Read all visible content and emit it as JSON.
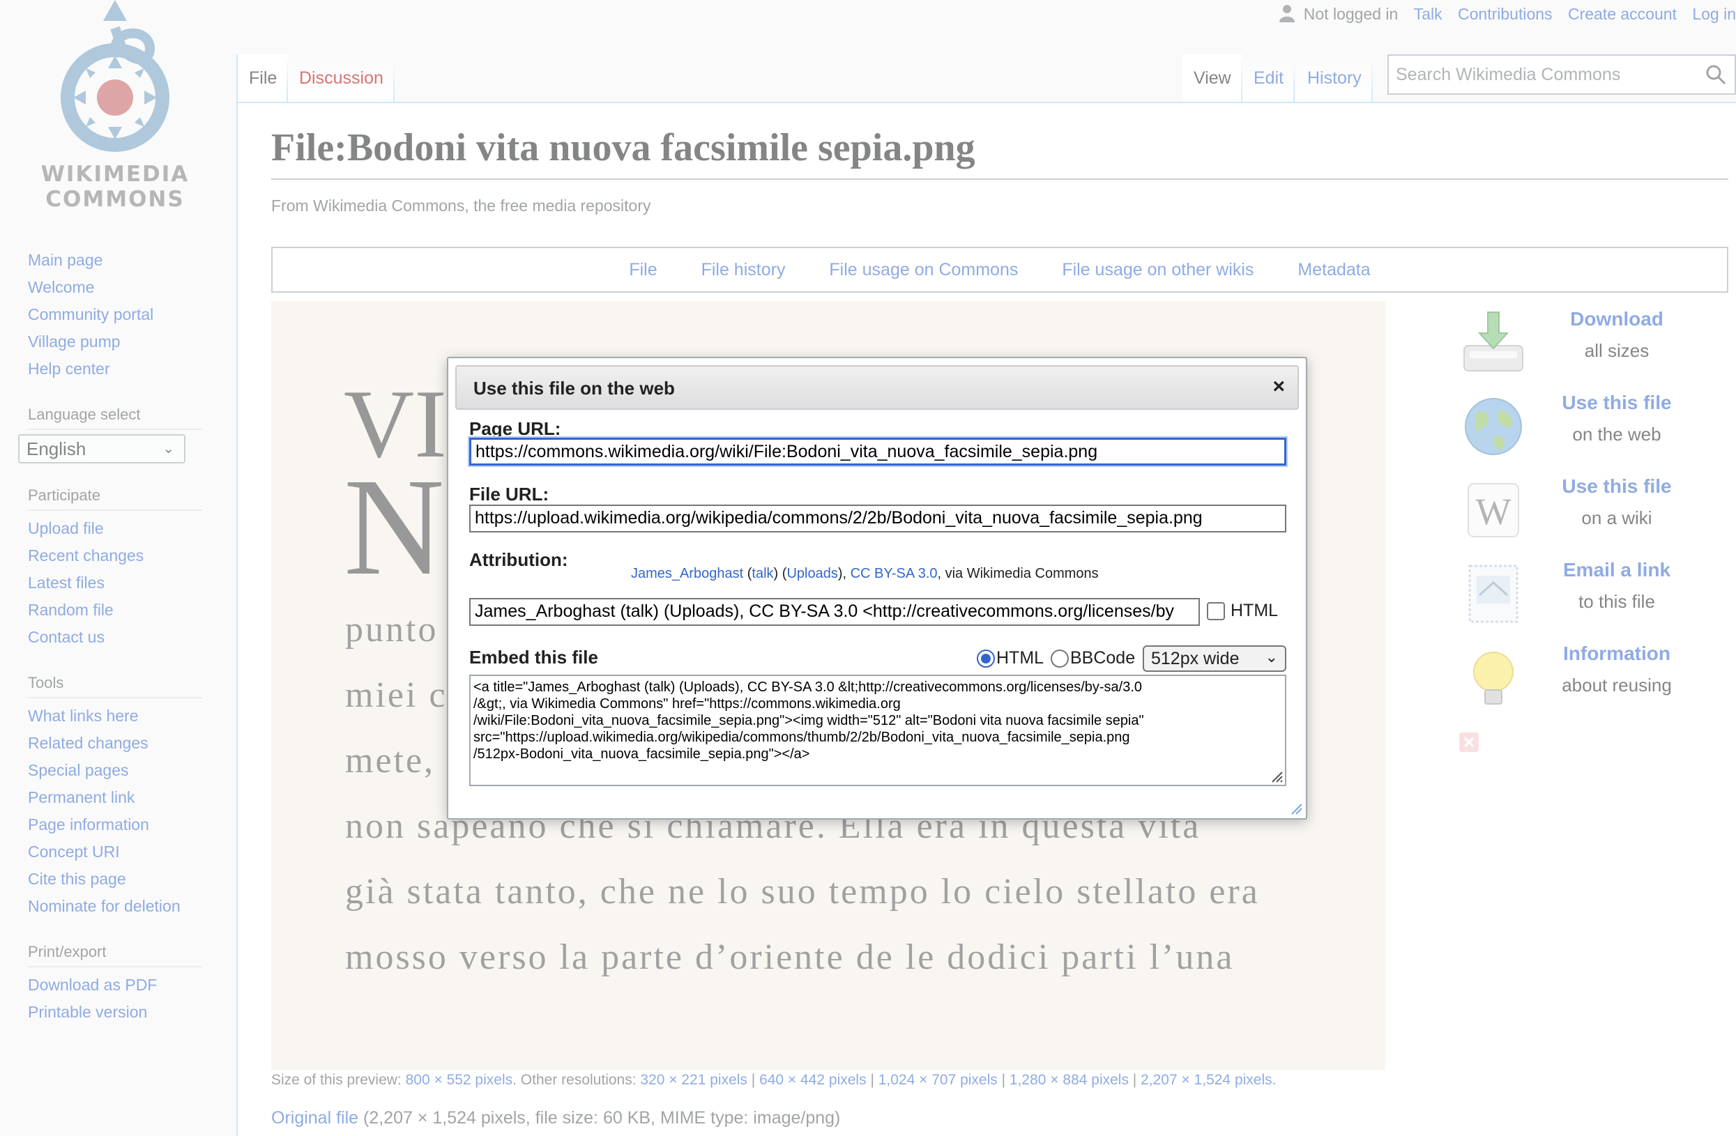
{
  "logo": {
    "line1": "WIKIMEDIA",
    "line2": "COMMONS"
  },
  "personal": {
    "not_logged_in": "Not logged in",
    "talk": "Talk",
    "contributions": "Contributions",
    "create_account": "Create account",
    "log_in": "Log in"
  },
  "sidebar": {
    "nav": [
      "Main page",
      "Welcome",
      "Community portal",
      "Village pump",
      "Help center"
    ],
    "language_head": "Language select",
    "language_value": "English",
    "participate_head": "Participate",
    "participate": [
      "Upload file",
      "Recent changes",
      "Latest files",
      "Random file",
      "Contact us"
    ],
    "tools_head": "Tools",
    "tools": [
      "What links here",
      "Related changes",
      "Special pages",
      "Permanent link",
      "Page information",
      "Concept URI",
      "Cite this page",
      "Nominate for deletion"
    ],
    "print_head": "Print/export",
    "print": [
      "Download as PDF",
      "Printable version"
    ]
  },
  "tabs": {
    "file": "File",
    "discussion": "Discussion",
    "view": "View",
    "edit": "Edit",
    "history": "History"
  },
  "search": {
    "placeholder": "Search Wikimedia Commons"
  },
  "page": {
    "title": "File:Bodoni vita nuova facsimile sepia.png",
    "tagline": "From Wikimedia Commons, the free media repository"
  },
  "filetoc": [
    "File",
    "File history",
    "File usage on Commons",
    "File usage on other wikis",
    "Metadata"
  ],
  "preview_text": {
    "big1": "VIT",
    "big2": "N",
    "lines": [
      "punto",
      "miei c",
      "mete,",
      "non sapeano che si chiamare. Ella era in questa vita",
      "già stata tanto, che ne lo suo tempo lo cielo stellato era",
      "mosso verso la parte d’oriente de le dodici parti l’una"
    ]
  },
  "preview_info": {
    "size_label": "Size of this preview: ",
    "size_value": "800 × 552 pixels",
    "other_label": ". Other resolutions: ",
    "res": [
      "320 × 221 pixels",
      "640 × 442 pixels",
      "1,024 × 707 pixels",
      "1,280 × 884 pixels",
      "2,207 × 1,524 pixels"
    ],
    "end": "."
  },
  "original": {
    "link": "Original file",
    "details": " (2,207 × 1,524 pixels, file size: 60 KB, MIME type: image/png)"
  },
  "actions": [
    {
      "t1": "Download",
      "t2": "all sizes"
    },
    {
      "t1": "Use this file",
      "t2": "on the web"
    },
    {
      "t1": "Use this file",
      "t2": "on a wiki"
    },
    {
      "t1": "Email a link",
      "t2": "to this file"
    },
    {
      "t1": "Information",
      "t2": "about reusing"
    }
  ],
  "dialog": {
    "title": "Use this file on the web",
    "close": "×",
    "page_url_label": "Page URL:",
    "page_url": "https://commons.wikimedia.org/wiki/File:Bodoni_vita_nuova_facsimile_sepia.png",
    "file_url_label": "File URL:",
    "file_url": "https://upload.wikimedia.org/wikipedia/commons/2/2b/Bodoni_vita_nuova_facsimile_sepia.png",
    "attribution_label": "Attribution:",
    "attr_author": "James_Arboghast",
    "attr_talk": "talk",
    "attr_uploads": "Uploads",
    "attr_license": "CC BY-SA 3.0",
    "attr_via": ", via Wikimedia Commons",
    "attribution_text": "James_Arboghast (talk) (Uploads), CC BY-SA 3.0 <http://creativecommons.org/licenses/by",
    "html_checkbox": "HTML",
    "embed_label": "Embed this file",
    "radio_html": "HTML",
    "radio_bbcode": "BBCode",
    "size_option": "512px wide",
    "embed_code": "<a title=\"James_Arboghast (talk) (Uploads), CC BY-SA 3.0 &lt;http://creativecommons.org/licenses/by-sa/3.0\n/&gt;, via Wikimedia Commons\" href=\"https://commons.wikimedia.org\n/wiki/File:Bodoni_vita_nuova_facsimile_sepia.png\"><img width=\"512\" alt=\"Bodoni vita nuova facsimile sepia\"\nsrc=\"https://upload.wikimedia.org/wikipedia/commons/thumb/2/2b/Bodoni_vita_nuova_facsimile_sepia.png\n/512px-Bodoni_vita_nuova_facsimile_sepia.png\"></a>"
  },
  "colors": {
    "link": "#3366cc",
    "border": "#a2a9b1",
    "preview_bg": "#f4efe5"
  }
}
